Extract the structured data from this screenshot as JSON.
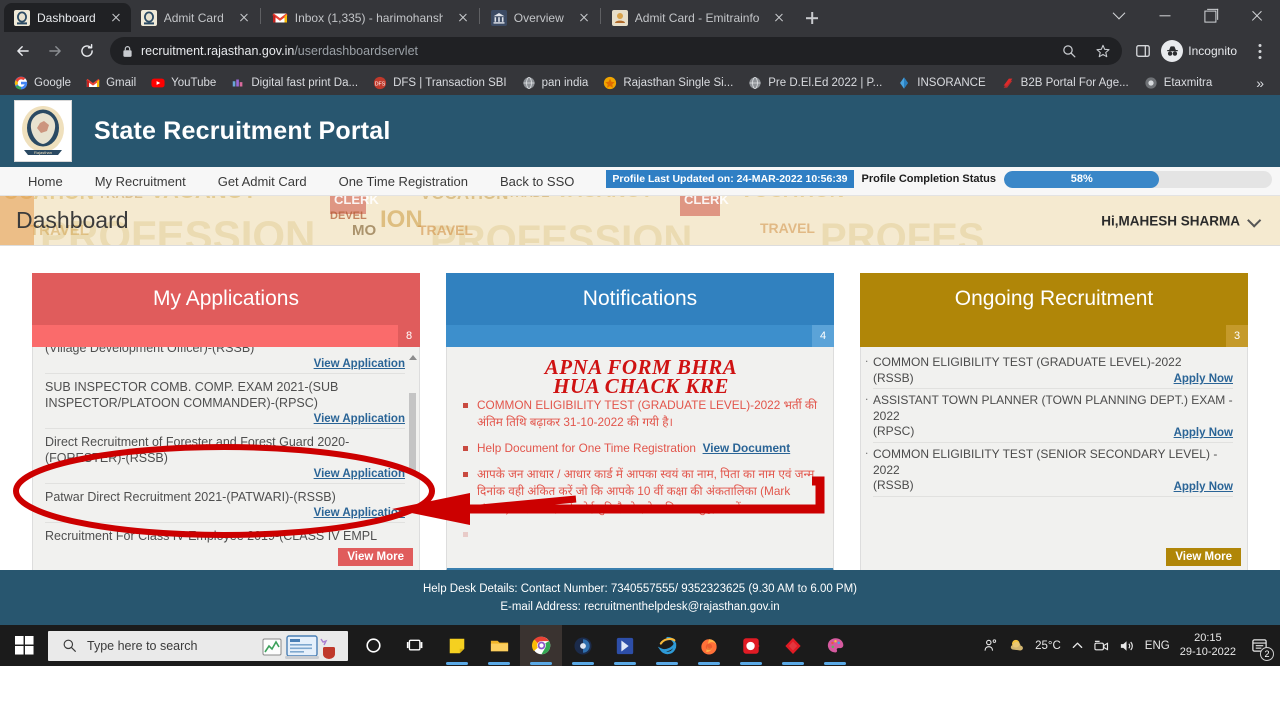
{
  "browser": {
    "tabs": [
      {
        "title": "Dashboard",
        "favicon": "rajasthan-emblem-icon",
        "active": true
      },
      {
        "title": "Admit Card",
        "favicon": "rajasthan-emblem-icon",
        "active": false
      },
      {
        "title": "Inbox (1,335) - harimohansha",
        "favicon": "gmail-icon",
        "active": false
      },
      {
        "title": "Overview",
        "favicon": "bank-icon",
        "active": false
      },
      {
        "title": "Admit Card - Emitrainfo",
        "favicon": "emitra-icon",
        "active": false
      }
    ],
    "new_tab_label": "+",
    "window_controls": {
      "chevron": "tab-search-chevron-icon",
      "minimize": "minimize-icon",
      "maximize": "maximize-icon",
      "close": "close-icon"
    },
    "address": {
      "host": "recruitment.rajasthan.gov.in",
      "path": "/userdashboardservlet",
      "lock": "lock-icon"
    },
    "profile_label": "Incognito",
    "bookmarks": [
      {
        "label": "Google",
        "icon": "google-icon"
      },
      {
        "label": "Gmail",
        "icon": "gmail-icon"
      },
      {
        "label": "YouTube",
        "icon": "youtube-icon"
      },
      {
        "label": "Digital fast print Da...",
        "icon": "generic-site-icon"
      },
      {
        "label": "DFS | Transaction SBI",
        "icon": "dfs-icon"
      },
      {
        "label": "pan india",
        "icon": "globe-icon"
      },
      {
        "label": "Rajasthan Single Si...",
        "icon": "rajasthan-icon"
      },
      {
        "label": "Pre D.El.Ed 2022 | P...",
        "icon": "globe-icon"
      },
      {
        "label": "INSORANCE",
        "icon": "diamond-icon"
      },
      {
        "label": "B2B Portal For Age...",
        "icon": "b2b-icon"
      },
      {
        "label": "Etaxmitra",
        "icon": "circle-icon"
      }
    ],
    "bookmarks_overflow": "»"
  },
  "site": {
    "title": "State Recruitment Portal",
    "emblem_alt": "rajasthan-state-emblem",
    "nav": [
      {
        "label": "Home"
      },
      {
        "label": "My Recruitment"
      },
      {
        "label": "Get Admit Card"
      },
      {
        "label": "One Time Registration"
      },
      {
        "label": "Back to SSO"
      }
    ],
    "profile_last_updated": "Profile Last Updated on: 24-MAR-2022 10:56:39",
    "profile_completion_label": "Profile Completion Status",
    "profile_completion_percent": "58%",
    "page_title": "Dashboard",
    "greeting": "Hi,MAHESH SHARMA"
  },
  "cards": {
    "my_applications": {
      "title": "My Applications",
      "count": "8",
      "view_more": "View More",
      "link_label": "View Application",
      "items": [
        {
          "title": "(Village Development Officer)-(RSSB)",
          "link": "View Application",
          "partial_top": true
        },
        {
          "title": "SUB INSPECTOR COMB. COMP. EXAM 2021-(SUB INSPECTOR/PLATOON COMMANDER)-(RPSC)",
          "link": "View Application"
        },
        {
          "title": "Direct Recruitment of Forester and Forest Guard 2020-(FORESTER)-(RSSB)",
          "link": "View Application",
          "highlighted": true
        },
        {
          "title": "Patwar Direct Recruitment 2021-(PATWARI)-(RSSB)",
          "link": "View Application"
        },
        {
          "title": "Recruitment For Class IV Employee 2019-(CLASS IV EMPL",
          "link": ""
        }
      ]
    },
    "notifications": {
      "title": "Notifications",
      "count": "4",
      "annotation_text_line1": "APNA FORM BHRA",
      "annotation_text_line2": "HUA CHACK KRE",
      "items": [
        {
          "text": "COMMON ELIGIBILITY TEST (GRADUATE LEVEL)-2022 भर्ती की अंतिम तिथि बढ़ाकर 31-10-2022 की गयी है।",
          "link": ""
        },
        {
          "text": "Help Document for One Time Registration",
          "link": "View Document"
        },
        {
          "text": "आपके जन आधार / आधार कार्ड में आपका स्वयं का नाम, पिता का नाम एवं जन्म दिनांक वही अंकित करें जो कि आपके 10 वीं कक्षा की अंकतालिका (Mark sheet) में हैं यदि इसमें कोई त्रुटि है तो इसे अविलम्ब शुद्ध करावें।",
          "link": ""
        }
      ]
    },
    "ongoing_recruitment": {
      "title": "Ongoing Recruitment",
      "count": "3",
      "view_more": "View More",
      "items": [
        {
          "title": "COMMON ELIGIBILITY TEST (GRADUATE LEVEL)-2022",
          "org": "(RSSB)",
          "link": "Apply Now"
        },
        {
          "title": "ASSISTANT TOWN PLANNER (TOWN PLANNING DEPT.) EXAM - 2022",
          "org": "(RPSC)",
          "link": "Apply Now"
        },
        {
          "title": "COMMON ELIGIBILITY TEST (SENIOR SECONDARY LEVEL) - 2022",
          "org": "(RSSB)",
          "link": "Apply Now"
        }
      ]
    }
  },
  "footer": {
    "line1": "Help Desk Details: Contact Number: 7340557555/ 9352323625 (9.30 AM to 6.00 PM)",
    "line2": "E-mail Address: recruitmenthelpdesk@rajasthan.gov.in"
  },
  "taskbar": {
    "search_placeholder": "Type here to search",
    "apps": [
      {
        "name": "cortana-icon"
      },
      {
        "name": "task-view-icon"
      },
      {
        "name": "sticky-notes-icon"
      },
      {
        "name": "file-explorer-icon"
      },
      {
        "name": "chrome-icon"
      },
      {
        "name": "photoshop-icon"
      },
      {
        "name": "lightroom-icon"
      },
      {
        "name": "internet-explorer-icon"
      },
      {
        "name": "firefox-icon"
      },
      {
        "name": "opera-gx-icon"
      },
      {
        "name": "avast-icon"
      },
      {
        "name": "paint-icon"
      }
    ],
    "people_icon": "people-icon",
    "weather": "25°C",
    "weather_icon": "partly-cloudy-icon",
    "tray_chevron": "show-hidden-icons-icon",
    "tray_camera": "camera-icon",
    "tray_volume": "volume-icon",
    "language": "ENG",
    "time": "20:15",
    "date": "29-10-2022",
    "notification_count": "2"
  },
  "colors": {
    "header_blue": "#28566f",
    "applications_red": "#e05c5c",
    "notifications_blue": "#3181bf",
    "ongoing_gold": "#b08608",
    "link_blue": "#2a6496",
    "annotation_red": "#cf1212"
  }
}
